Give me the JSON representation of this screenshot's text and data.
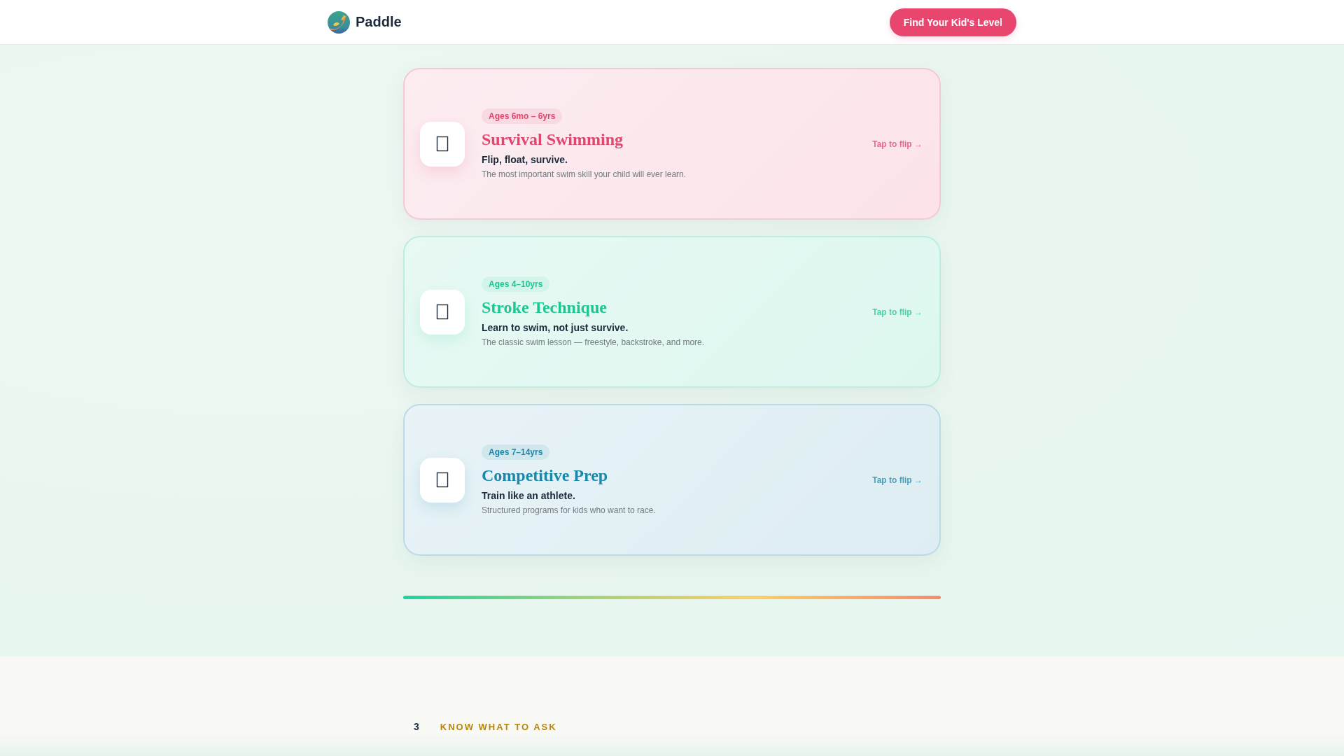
{
  "header": {
    "brand": "Paddle",
    "cta": "Find Your Kid's Level"
  },
  "programs": [
    {
      "badge": "Ages 6mo – 6yrs",
      "title": "Survival Swimming",
      "tagline": "Flip, float, survive.",
      "description": "The most important swim skill your child will ever learn.",
      "flip_hint": "Tap to flip →",
      "color": "#e2466f"
    },
    {
      "badge": "Ages 4–10yrs",
      "title": "Stroke Technique",
      "tagline": "Learn to swim, not just survive.",
      "description": "The classic swim lesson — freestyle, backstroke, and more.",
      "flip_hint": "Tap to flip →",
      "color": "#1dc794"
    },
    {
      "badge": "Ages 7–14yrs",
      "title": "Competitive Prep",
      "tagline": "Train like an athlete.",
      "description": "Structured programs for kids who want to race.",
      "flip_hint": "Tap to flip →",
      "color": "#1a88ab"
    }
  ],
  "next_section": {
    "number": "3",
    "eyebrow": "KNOW WHAT TO ASK"
  }
}
